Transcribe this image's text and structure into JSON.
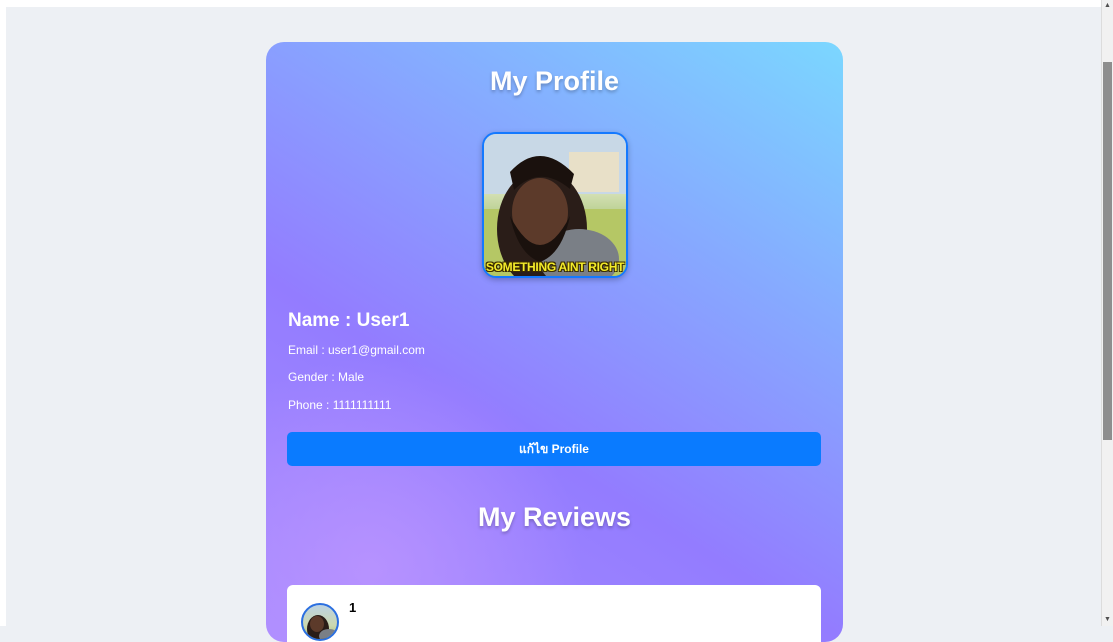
{
  "profile": {
    "title": "My Profile",
    "avatar_caption": "SOMETHING AINT RIGHT",
    "name": "Name : User1",
    "email": "Email : user1@gmail.com",
    "gender": "Gender : Male",
    "phone": "Phone : 1111111111",
    "edit_button": "แก้ไข Profile"
  },
  "reviews": {
    "title": "My Reviews",
    "items": [
      {
        "label": "1"
      }
    ]
  },
  "colors": {
    "page_bg": "#edf0f4",
    "button_bg": "#0a7bff",
    "avatar_border": "#1479ff",
    "gradient_start": "#7bd7ff",
    "gradient_end": "#937cff"
  }
}
